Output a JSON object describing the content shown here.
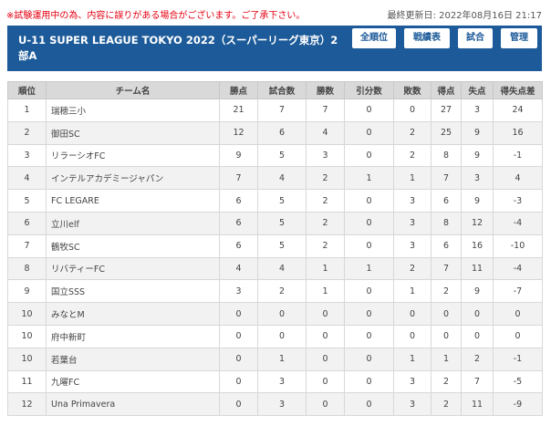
{
  "notice": "※試験運用中の為、内容に誤りがある場合がございます。ご了承下さい。",
  "updated": "最終更新日: 2022年08月16日 21:17",
  "header": {
    "title": "U-11 SUPER LEAGUE TOKYO 2022（スーパーリーグ東京）2部A",
    "buttons": [
      "全順位",
      "戦績表",
      "試合",
      "管理"
    ]
  },
  "table": {
    "columns": [
      "順位",
      "チーム名",
      "勝点",
      "試合数",
      "勝数",
      "引分数",
      "敗数",
      "得点",
      "失点",
      "得失点差"
    ],
    "rows": [
      [
        "1",
        "瑞穂三小",
        "21",
        "7",
        "7",
        "0",
        "0",
        "27",
        "3",
        "24"
      ],
      [
        "2",
        "御田SC",
        "12",
        "6",
        "4",
        "0",
        "2",
        "25",
        "9",
        "16"
      ],
      [
        "3",
        "リラーシオFC",
        "9",
        "5",
        "3",
        "0",
        "2",
        "8",
        "9",
        "-1"
      ],
      [
        "4",
        "インテルアカデミージャパン",
        "7",
        "4",
        "2",
        "1",
        "1",
        "7",
        "3",
        "4"
      ],
      [
        "5",
        "FC LEGARE",
        "6",
        "5",
        "2",
        "0",
        "3",
        "6",
        "9",
        "-3"
      ],
      [
        "6",
        "立川elf",
        "6",
        "5",
        "2",
        "0",
        "3",
        "8",
        "12",
        "-4"
      ],
      [
        "7",
        "鶴牧SC",
        "6",
        "5",
        "2",
        "0",
        "3",
        "6",
        "16",
        "-10"
      ],
      [
        "8",
        "リバティーFC",
        "4",
        "4",
        "1",
        "1",
        "2",
        "7",
        "11",
        "-4"
      ],
      [
        "9",
        "国立SSS",
        "3",
        "2",
        "1",
        "0",
        "1",
        "2",
        "9",
        "-7"
      ],
      [
        "10",
        "みなとM",
        "0",
        "0",
        "0",
        "0",
        "0",
        "0",
        "0",
        "0"
      ],
      [
        "10",
        "府中新町",
        "0",
        "0",
        "0",
        "0",
        "0",
        "0",
        "0",
        "0"
      ],
      [
        "10",
        "若葉台",
        "0",
        "1",
        "0",
        "0",
        "1",
        "1",
        "2",
        "-1"
      ],
      [
        "11",
        "九曜FC",
        "0",
        "3",
        "0",
        "0",
        "3",
        "2",
        "7",
        "-5"
      ],
      [
        "12",
        "Una Primavera",
        "0",
        "3",
        "0",
        "0",
        "3",
        "2",
        "11",
        "-9"
      ]
    ]
  }
}
